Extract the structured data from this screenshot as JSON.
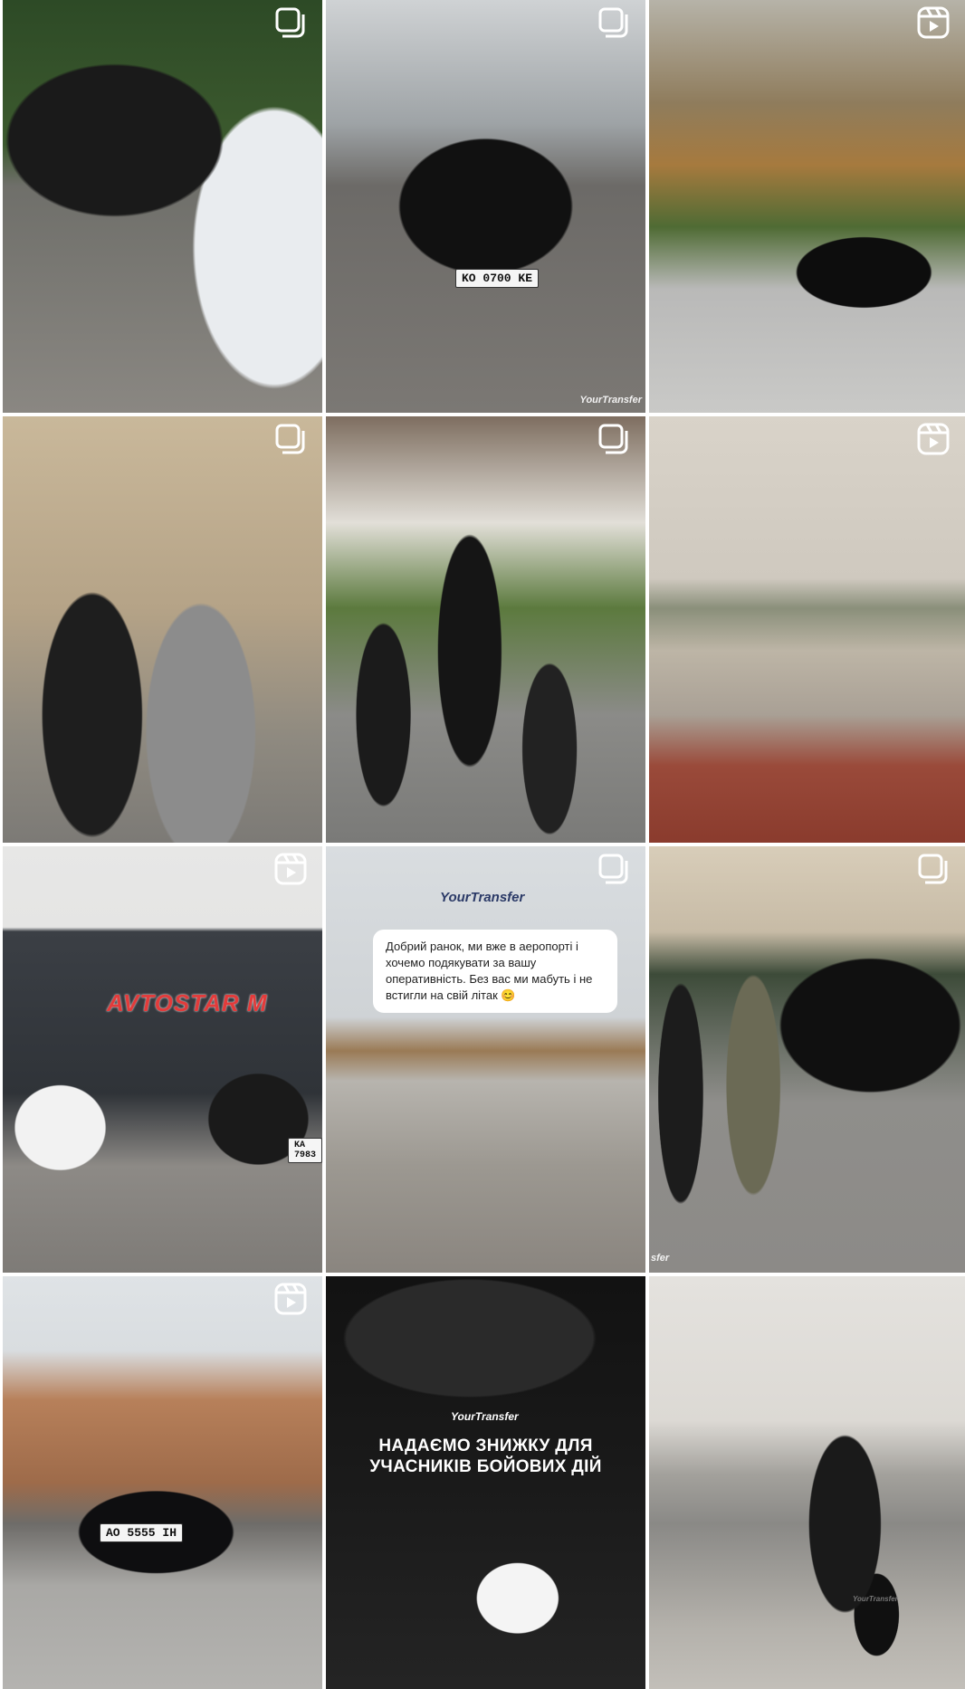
{
  "colors": {
    "badge": "#ffffff",
    "brand_navy": "#2b3a67",
    "sign_red": "#e23b3b"
  },
  "icons": {
    "carousel": "carousel-icon",
    "reel": "reel-icon"
  },
  "posts": [
    {
      "type": "carousel",
      "text": {}
    },
    {
      "type": "carousel",
      "text": {
        "plate": "KO 0700 KE",
        "watermark": "YourTransfer"
      }
    },
    {
      "type": "reel",
      "text": {}
    },
    {
      "type": "carousel",
      "text": {}
    },
    {
      "type": "carousel",
      "text": {}
    },
    {
      "type": "reel",
      "text": {}
    },
    {
      "type": "reel",
      "text": {
        "sign": "AVTOSTAR M",
        "plate": "KA 7983"
      }
    },
    {
      "type": "carousel",
      "text": {
        "brand": "YourTransfer",
        "message": "Добрий ранок, ми вже в аеропорті і хочемо подякувати за вашу оперативність. Без вас ми мабуть і не встигли на свій літак 😊"
      }
    },
    {
      "type": "carousel",
      "text": {
        "watermark": "sfer"
      }
    },
    {
      "type": "reel",
      "text": {
        "plate": "AO 5555 IH"
      }
    },
    {
      "type": "image",
      "text": {
        "brand": "YourTransfer",
        "headline": "НАДАЄМО ЗНИЖКУ ДЛЯ УЧАСНИКІВ БОЙОВИХ ДІЙ"
      }
    },
    {
      "type": "image",
      "text": {
        "luggage_label": "YourTransfer"
      }
    }
  ]
}
